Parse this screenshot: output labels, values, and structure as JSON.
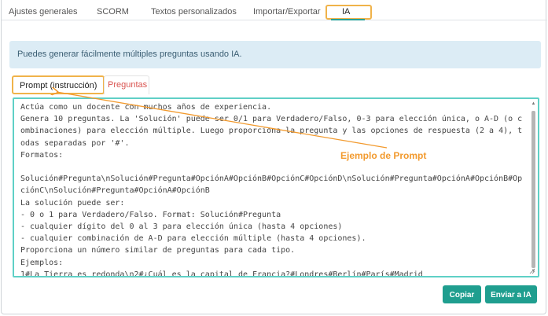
{
  "top_tabs": [
    {
      "label": "Ajustes generales",
      "active": false
    },
    {
      "label": "SCORM",
      "active": false
    },
    {
      "label": "Textos personalizados",
      "active": false
    },
    {
      "label": "Importar/Exportar",
      "active": false
    },
    {
      "label": "IA",
      "active": true
    }
  ],
  "info_alert": "Puedes generar fácilmente múltiples preguntas usando IA.",
  "sub_tabs": [
    {
      "label": "Prompt (instrucción)",
      "active": true
    },
    {
      "label": "Preguntas",
      "active": false
    }
  ],
  "prompt_text": "Actúa como un docente con muchos años de experiencia.\nGenera 10 preguntas. La 'Solución' puede ser 0/1 para Verdadero/Falso, 0-3 para elección única, o A-D (o combinaciones) para elección múltiple. Luego proporciona la pregunta y las opciones de respuesta (2 a 4), todas separadas por '#'.\nFormatos:\n\nSolución#Pregunta\\nSolución#Pregunta#OpciónA#OpciónB#OpciónC#OpciónD\\nSolución#Pregunta#OpciónA#OpciónB#OpciónC\\nSolución#Pregunta#OpciónA#OpciónB\nLa solución puede ser:\n- 0 o 1 para Verdadero/Falso. Format: Solución#Pregunta\n- cualquier dígito del 0 al 3 para elección única (hasta 4 opciones)\n- cualquier combinación de A-D para elección múltiple (hasta 4 opciones).\nProporciona un número similar de preguntas para cada tipo.\nEjemplos:\n1#La Tierra es redonda\\n2#¿Cuál es la capital de Francia?#Londres#Berlín#París#Madrid",
  "annotation": "Ejemplo de Prompt",
  "buttons": {
    "copy": "Copiar",
    "send": "Enviar a IA"
  },
  "colors": {
    "accent": "#1f9e8f",
    "highlight": "#f0b34a",
    "annotation": "#f29a2e",
    "alert_bg": "#dcecf5",
    "textarea_border": "#5fd0c6"
  }
}
